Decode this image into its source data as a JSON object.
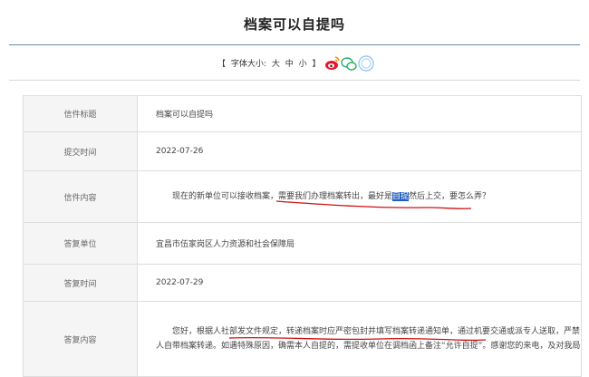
{
  "page": {
    "title": "档案可以自提吗"
  },
  "toolbar": {
    "bracket_open": "【",
    "font_size_label": "字体大小:",
    "sizes": [
      "大",
      "中",
      "小"
    ],
    "bracket_close": "】",
    "share_icons": [
      "weibo-icon",
      "wechat-icon",
      "qq-icon"
    ]
  },
  "rows": [
    {
      "label": "信件标题",
      "value": "档案可以自提吗"
    },
    {
      "label": "提交时间",
      "value": "2022-07-26"
    },
    {
      "label": "信件内容",
      "value_a": "现在的新单位可以接收档案，需要我们办理档案转出，最好是",
      "value_hl": "自提",
      "value_b": "然后上交，要怎么弄？"
    },
    {
      "label": "答复单位",
      "value": "宜昌市伍家岗区人力资源和社会保障局"
    },
    {
      "label": "答复时间",
      "value": "2022-07-29"
    },
    {
      "label": "答复内容",
      "value_line1": "您好，根据人社部发文件规定，转递档案时应严密包封并填写档案转递通知单，通过机要交通或派专人送取，严禁个",
      "value_line2": "人自带档案转递。如遇特殊原因，确需本人自提的，需提收单位在调档函上备注“允许自提”。感谢您的来电，及对我局"
    }
  ],
  "colors": {
    "rule": "#6a87a8",
    "label_bg": "#f5f5f5",
    "highlight": "#1f5fbf",
    "annotation": "#cc1111",
    "weibo": "#e6162d",
    "wechat": "#2aae67",
    "qq": "#9cc7ef"
  }
}
